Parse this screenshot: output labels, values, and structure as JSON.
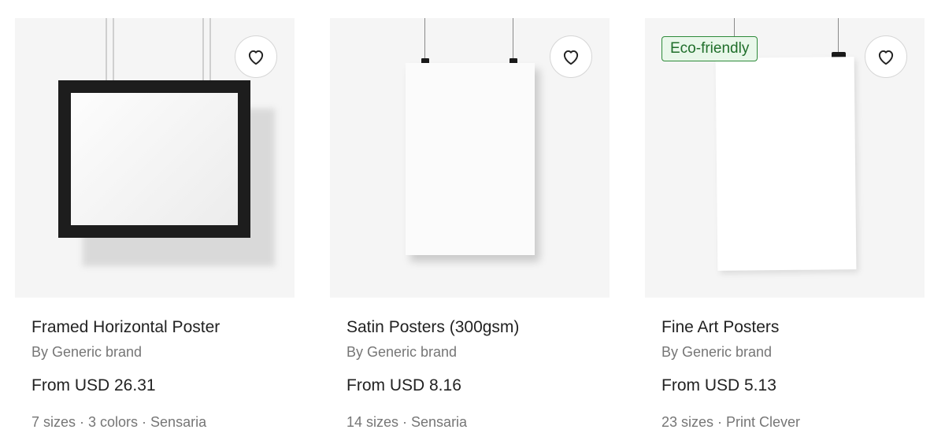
{
  "products": [
    {
      "title": "Framed Horizontal Poster",
      "brand": "By Generic brand",
      "price": "From USD 26.31",
      "meta": "7 sizes · 3 colors · Sensaria"
    },
    {
      "title": "Satin Posters (300gsm)",
      "brand": "By Generic brand",
      "price": "From USD 8.16",
      "meta": "14 sizes · Sensaria"
    },
    {
      "title": "Fine Art Posters",
      "brand": "By Generic brand",
      "price": "From USD 5.13",
      "meta": "23 sizes · Print Clever",
      "badge": "Eco-friendly"
    }
  ],
  "icons": {
    "favorite": "heart-outline-icon"
  },
  "colors": {
    "image_bg": "#f5f5f5",
    "badge_border": "#2e8b3a",
    "badge_bg": "#e9f7ea",
    "text_muted": "#767676"
  }
}
